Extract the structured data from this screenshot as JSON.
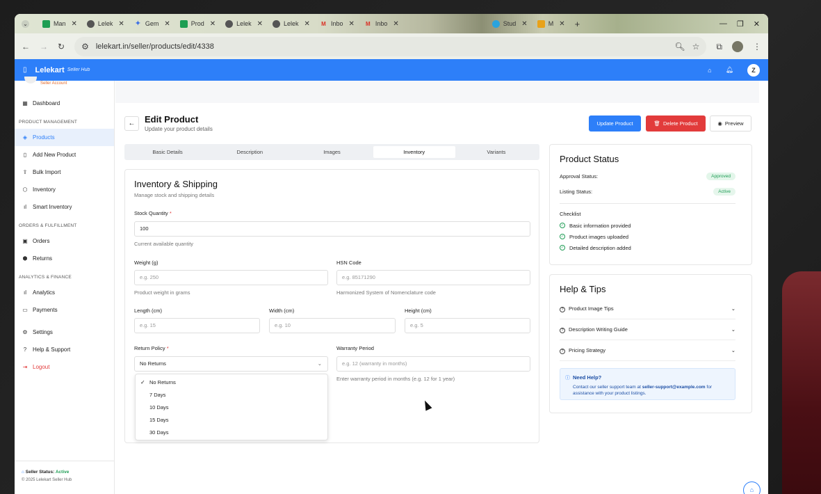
{
  "browser": {
    "tabs": [
      {
        "label": "Man",
        "icon": "sheets-icon"
      },
      {
        "label": "Lelek",
        "icon": "globe-icon"
      },
      {
        "label": "Gem",
        "icon": "gemini-icon"
      },
      {
        "label": "Prod",
        "icon": "sheets-icon"
      },
      {
        "label": "Lelek",
        "icon": "globe-icon"
      },
      {
        "label": "Lelek",
        "icon": "globe-icon"
      },
      {
        "label": "Inbo",
        "icon": "gmail-icon"
      },
      {
        "label": "Inbo",
        "icon": "gmail-icon"
      },
      {
        "label": "Stud",
        "icon": "telegram-icon"
      },
      {
        "label": "M",
        "icon": "app-icon"
      }
    ],
    "url": "lelekart.in/seller/products/edit/4338"
  },
  "appbar": {
    "brand": "Lelekart",
    "hub": "Seller Hub",
    "avatar": "Z"
  },
  "sidebar": {
    "account_label": "Seller Account",
    "items_top": [
      {
        "label": "Dashboard",
        "icon": "grid-icon"
      }
    ],
    "section_product": "PRODUCT MANAGEMENT",
    "items_product": [
      {
        "label": "Products",
        "icon": "layers-icon"
      },
      {
        "label": "Add New Product",
        "icon": "bookmark-icon"
      },
      {
        "label": "Bulk Import",
        "icon": "upload-icon"
      },
      {
        "label": "Inventory",
        "icon": "box-icon"
      },
      {
        "label": "Smart Inventory",
        "icon": "bars-icon"
      }
    ],
    "section_orders": "ORDERS & FULFILLMENT",
    "items_orders": [
      {
        "label": "Orders",
        "icon": "bag-icon"
      },
      {
        "label": "Returns",
        "icon": "return-icon"
      }
    ],
    "section_analytics": "ANALYTICS & FINANCE",
    "items_analytics": [
      {
        "label": "Analytics",
        "icon": "chart-icon"
      },
      {
        "label": "Payments",
        "icon": "card-icon"
      }
    ],
    "items_bottom": [
      {
        "label": "Settings",
        "icon": "gear-icon"
      },
      {
        "label": "Help & Support",
        "icon": "help-icon"
      },
      {
        "label": "Logout",
        "icon": "logout-icon"
      }
    ],
    "footer": {
      "status_label": "Seller Status: ",
      "status_value": "Active",
      "copyright": "© 2025 Lelekart Seller Hub"
    }
  },
  "page": {
    "title": "Edit Product",
    "subtitle": "Update your product details",
    "update_btn": "Update Product",
    "delete_btn": "Delete Product",
    "preview_btn": "Preview",
    "tabs": [
      "Basic Details",
      "Description",
      "Images",
      "Inventory",
      "Variants"
    ],
    "active_tab": "Inventory"
  },
  "inventory": {
    "title": "Inventory & Shipping",
    "subtitle": "Manage stock and shipping details",
    "stock_label": "Stock Quantity",
    "stock_value": "100",
    "stock_help": "Current available quantity",
    "weight_label": "Weight (g)",
    "weight_placeholder": "e.g. 250",
    "weight_help": "Product weight in grams",
    "hsn_label": "HSN Code",
    "hsn_placeholder": "e.g. 85171290",
    "hsn_help": "Harmonized System of Nomenclature code",
    "length_label": "Length (cm)",
    "length_placeholder": "e.g. 15",
    "width_label": "Width (cm)",
    "width_placeholder": "e.g. 10",
    "height_label": "Height (cm)",
    "height_placeholder": "e.g. 5",
    "return_label": "Return Policy",
    "return_value": "No Returns",
    "return_options": [
      "No Returns",
      "7 Days",
      "10 Days",
      "15 Days",
      "30 Days"
    ],
    "warranty_label": "Warranty Period",
    "warranty_placeholder": "e.g. 12 (warranty in months)",
    "warranty_help": "Enter warranty period in months (e.g. 12 for 1 year)"
  },
  "status": {
    "title": "Product Status",
    "approval_label": "Approval Status:",
    "approval_value": "Approved",
    "listing_label": "Listing Status:",
    "listing_value": "Active",
    "checklist_label": "Checklist",
    "checklist": [
      "Basic information provided",
      "Product images uploaded",
      "Detailed description added"
    ]
  },
  "tips": {
    "title": "Help & Tips",
    "items": [
      "Product Image Tips",
      "Description Writing Guide",
      "Pricing Strategy"
    ],
    "need_help_title": "Need Help?",
    "need_help_text1": "Contact our seller support team at ",
    "need_help_email": "seller-support@example.com",
    "need_help_text2": " for assistance with your product listings."
  },
  "colors": {
    "primary": "#2d7ff9",
    "danger": "#e23b3b",
    "success": "#1f9d55"
  }
}
